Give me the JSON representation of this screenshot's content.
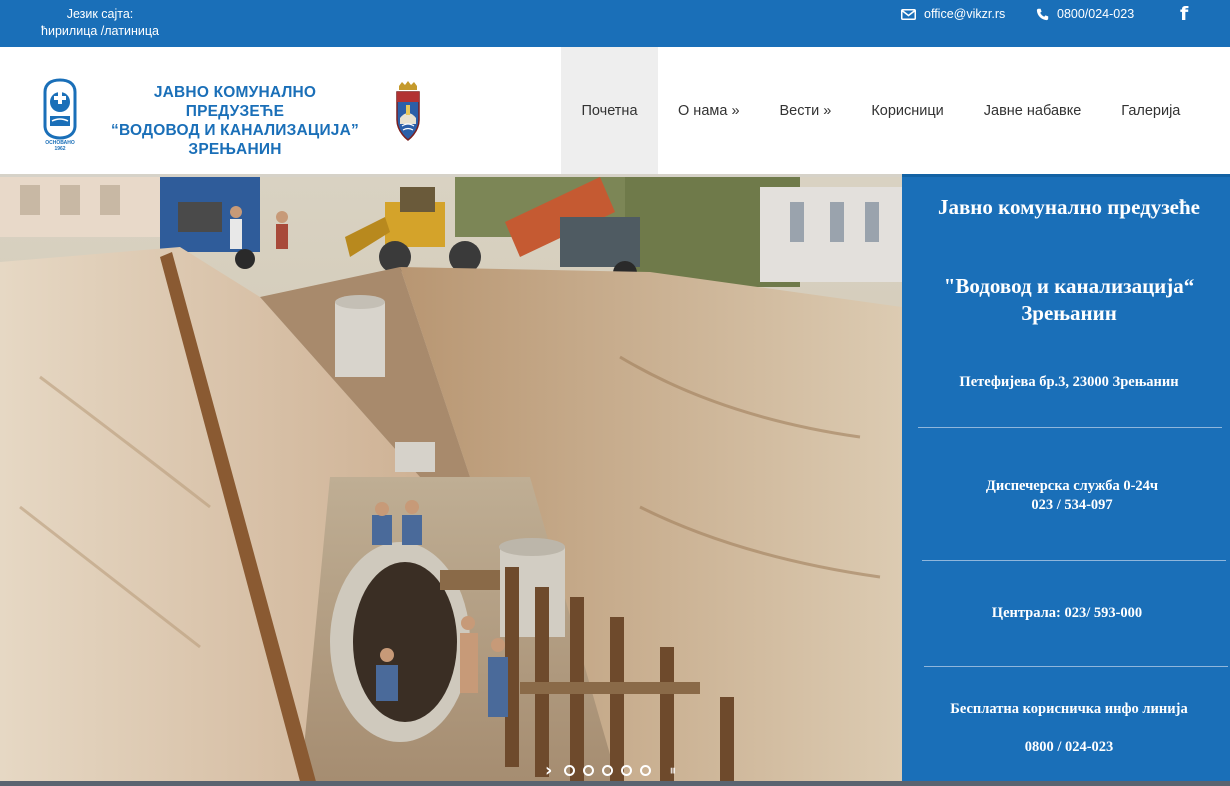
{
  "topbar": {
    "lang_label": "Језик сајта:",
    "lang_cyr": "ћирилица",
    "lang_sep": " /",
    "lang_lat": "латиница",
    "email": "office@vikzr.rs",
    "phone": "0800/024-023",
    "facebook_icon": "facebook-icon"
  },
  "logo": {
    "line1": "ЈАВНО КОМУНАЛНО ПРЕДУЗЕЋЕ",
    "line2": "“ВОДОВОД И КАНАЛИЗАЦИЈА”",
    "line3": "ЗРЕЊАНИН",
    "emblem_text1": "ОСНОВАНО",
    "emblem_text2": "1962"
  },
  "nav": {
    "items": [
      {
        "label": "Почетна"
      },
      {
        "label": "О нама »"
      },
      {
        "label": "Вести »"
      },
      {
        "label": "Корисници"
      },
      {
        "label": "Јавне набавке"
      },
      {
        "label": "Галерија"
      }
    ],
    "active_index": 0
  },
  "slider": {
    "dot_count": 5,
    "next_icon": "chevron-right-icon",
    "pause_icon": "pause-icon"
  },
  "info": {
    "title": "Јавно комунално предузеће",
    "name_line1": "\"Водовод и канализација“",
    "name_line2": "Зрењанин",
    "address": "Петефијева бр.3, 23000 Зрењанин",
    "dispatch_label": "Диспечерска служба  0-24ч",
    "dispatch_phone": "023 / 534-097",
    "central": "Централа: 023/ 593-000",
    "info_line_label": "Бесплатна корисничка инфо линија",
    "info_line_phone": "0800 / 024-023"
  },
  "colors": {
    "brand_blue": "#1a6fb8",
    "nav_active_bg": "#eeeeee"
  }
}
